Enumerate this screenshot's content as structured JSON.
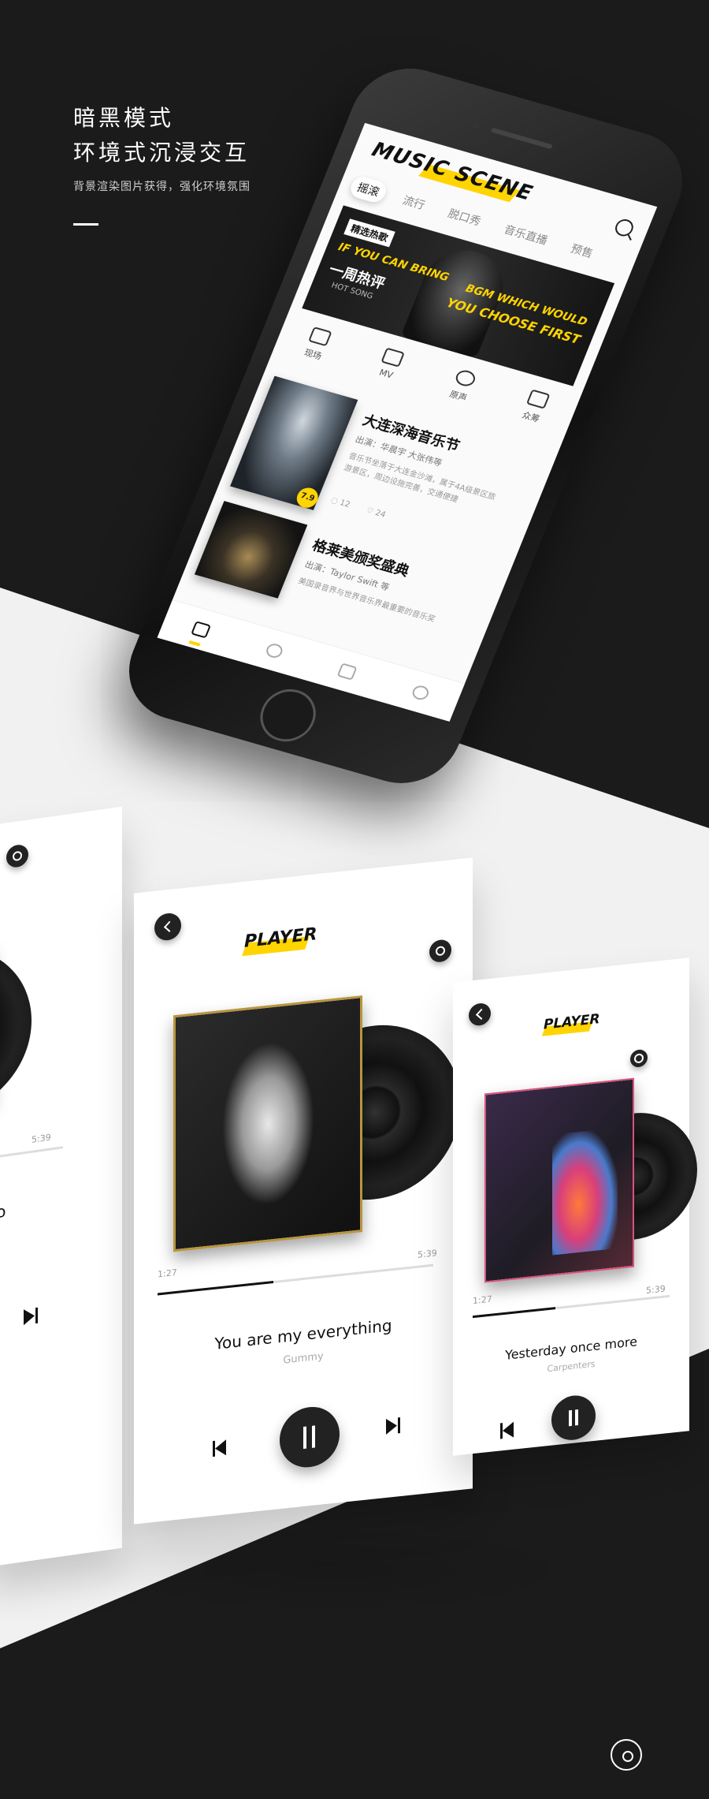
{
  "hero": {
    "title_line1": "暗黑模式",
    "title_line2": "环境式沉浸交互",
    "subtitle": "背景渲染图片获得，强化环境氛围"
  },
  "app": {
    "logo": "MUSIC SCENE",
    "tabs": [
      "摇滚",
      "流行",
      "脱口秀",
      "音乐直播",
      "预售"
    ],
    "banner": {
      "tag": "精选热歌",
      "left_line1": "IF YOU CAN BRING",
      "left_line2": "一周热评",
      "left_line3": "HOT SONG",
      "right_line1": "BGM WHICH WOULD",
      "right_line2": "YOU CHOOSE FIRST"
    },
    "categories": [
      "现场",
      "MV",
      "原声",
      "众筹"
    ],
    "cards": [
      {
        "title": "大连深海音乐节",
        "sub": "出演：华晨宇 大张伟等",
        "desc": "音乐节坐落于大连金沙滩，属于4A级景区旅游景区，周边设施完善，交通便捷",
        "score": "7.9",
        "comments": "12",
        "likes": "24"
      },
      {
        "title": "格莱美颁奖盛典",
        "sub": "出演：Taylor Swift 等",
        "desc": "美国录音界与世界音乐界最重要的音乐奖"
      }
    ]
  },
  "players": {
    "logo": "PLAYER",
    "left": {
      "total": "5:39",
      "song_fragment": "do"
    },
    "mid": {
      "current": "1:27",
      "total": "5:39",
      "progress": 0.42,
      "song": "You are my everything",
      "artist": "Gummy"
    },
    "right": {
      "current": "1:27",
      "total": "5:39",
      "progress": 0.42,
      "song": "Yesterday once more",
      "artist": "Carpenters"
    }
  },
  "colors": {
    "accent": "#ffd400",
    "dark": "#1b1b1b",
    "light": "#f1f1f1"
  }
}
